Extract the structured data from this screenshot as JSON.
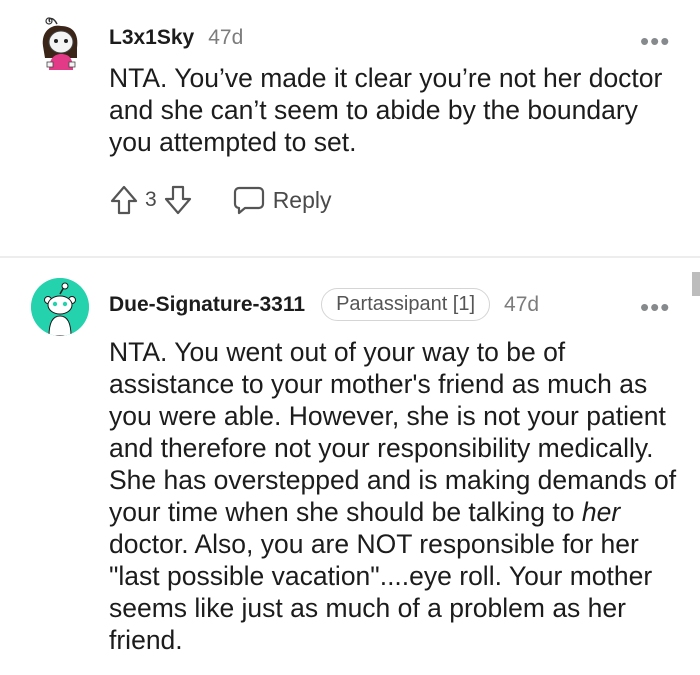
{
  "comments": [
    {
      "username": "L3x1Sky",
      "age": "47d",
      "body": "NTA. You’ve made it clear you’re not her doctor and she can’t seem to abide by the boundary you attempted to set.",
      "votes": "3",
      "reply_label": "Reply",
      "more_label": "•••"
    },
    {
      "username": "Due-Signature-3311",
      "flair": "Partassipant [1]",
      "age": "47d",
      "body_parts": [
        "NTA. You went out of your way to be of assistance to your mother's friend as much as you were able. However, she is not your patient and therefore not your responsibility medically. She has overstepped and is making demands of your time when she should be talking to ",
        "her",
        " doctor. Also, you are NOT responsible for her \"last possible vacation\"....eye roll. Your mother seems like just as much of a problem as her friend."
      ],
      "more_label": "•••"
    }
  ],
  "colors": {
    "text": "#1c1c1c",
    "meta": "#7c7c7c",
    "avatar_teal": "#24d3ad",
    "divider": "#ededed"
  }
}
